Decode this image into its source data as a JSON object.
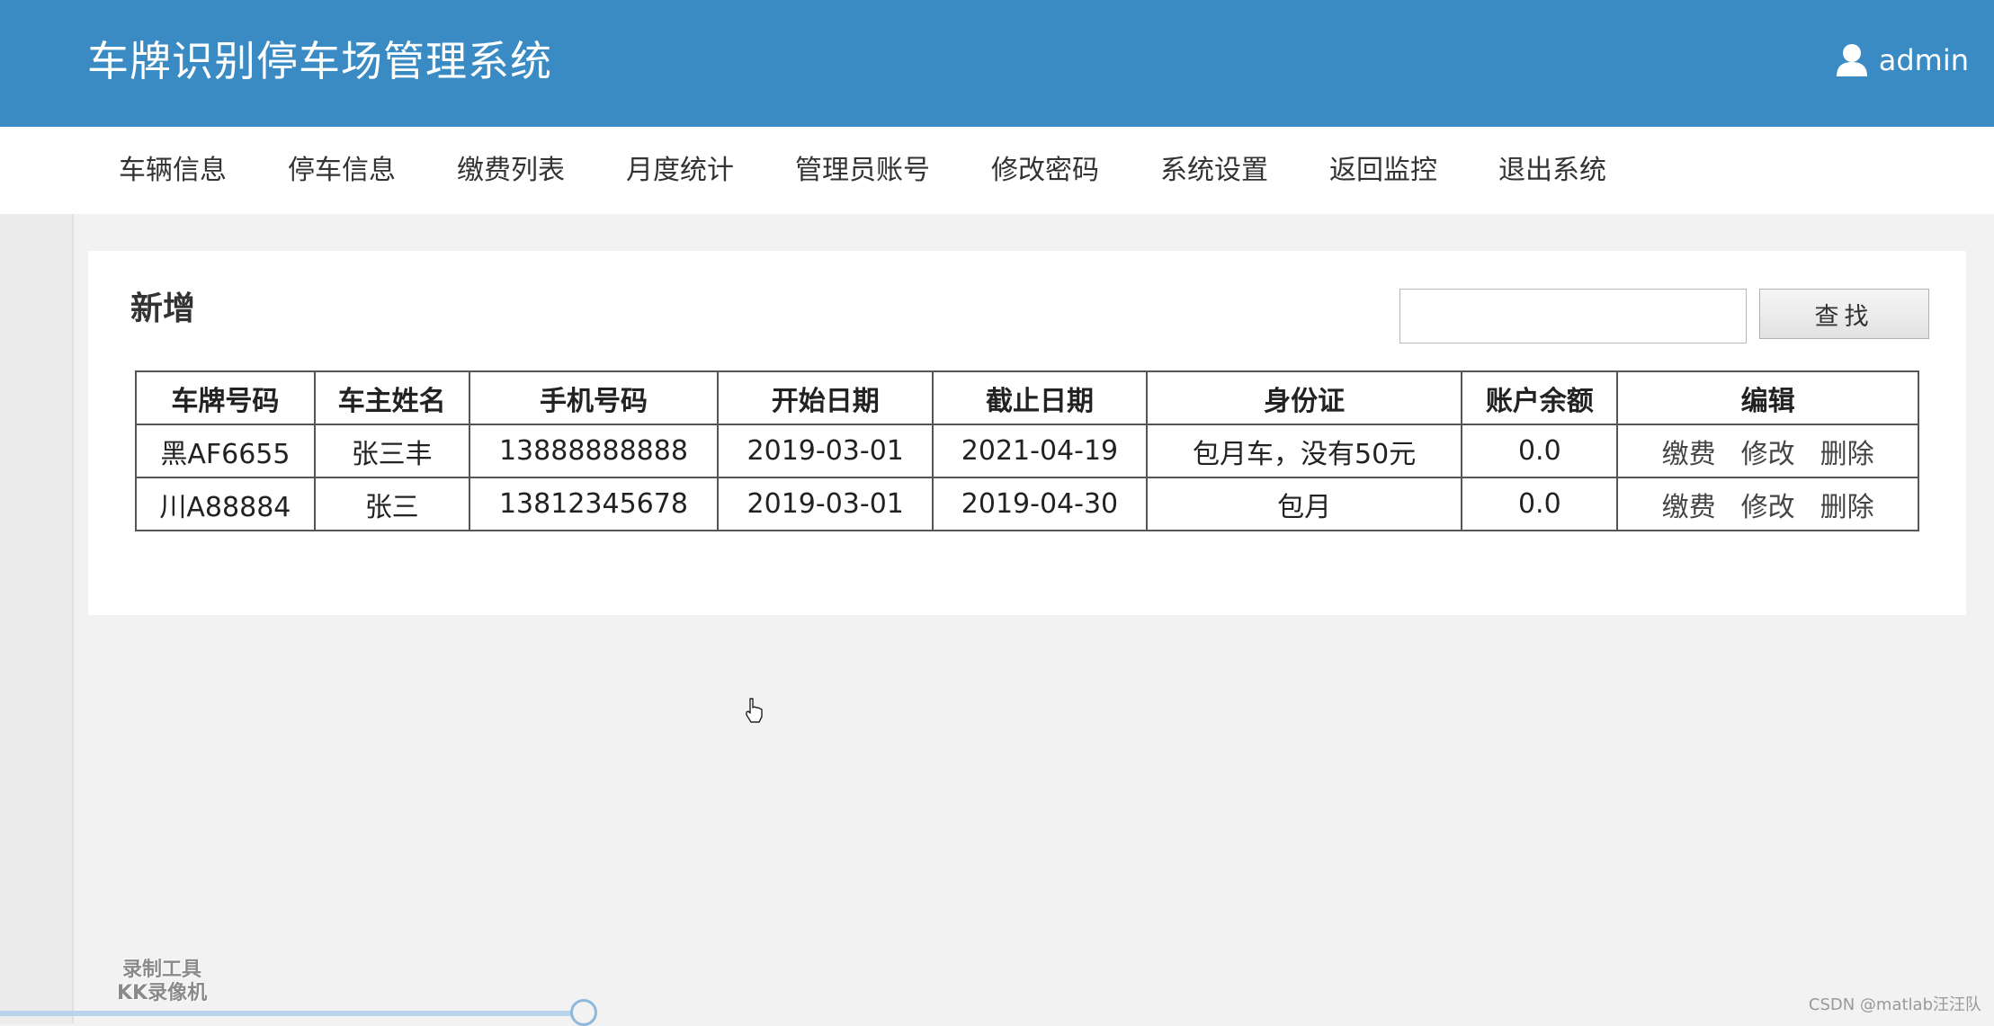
{
  "header": {
    "title": "车牌识别停车场管理系统",
    "user_name": "admin",
    "user_icon": "user-icon"
  },
  "nav": {
    "items": [
      {
        "label": "车辆信息"
      },
      {
        "label": "停车信息"
      },
      {
        "label": "缴费列表"
      },
      {
        "label": "月度统计"
      },
      {
        "label": "管理员账号"
      },
      {
        "label": "修改密码"
      },
      {
        "label": "系统设置"
      },
      {
        "label": "返回监控"
      },
      {
        "label": "退出系统"
      }
    ]
  },
  "panel": {
    "add_label": "新增",
    "search": {
      "value": "",
      "placeholder": "",
      "button_label": "查找"
    }
  },
  "table": {
    "headers": [
      "车牌号码",
      "车主姓名",
      "手机号码",
      "开始日期",
      "截止日期",
      "身份证",
      "账户余额",
      "编辑"
    ],
    "rows": [
      {
        "plate": "黑AF6655",
        "owner": "张三丰",
        "phone": "13888888888",
        "start_date": "2019-03-01",
        "end_date": "2021-04-19",
        "id_card": "包月车，没有50元",
        "balance": "0.0"
      },
      {
        "plate": "川A88884",
        "owner": "张三",
        "phone": "13812345678",
        "start_date": "2019-03-01",
        "end_date": "2019-04-30",
        "id_card": "包月",
        "balance": "0.0"
      }
    ],
    "actions": {
      "pay": "缴费",
      "edit": "修改",
      "delete": "删除"
    }
  },
  "overlay": {
    "watermark_line1": "录制工具",
    "watermark_line2": "KK录像机",
    "credit": "CSDN @matlab汪汪队"
  },
  "colors": {
    "header_bg": "#3a8bc4",
    "page_bg": "#f2f2f2"
  }
}
